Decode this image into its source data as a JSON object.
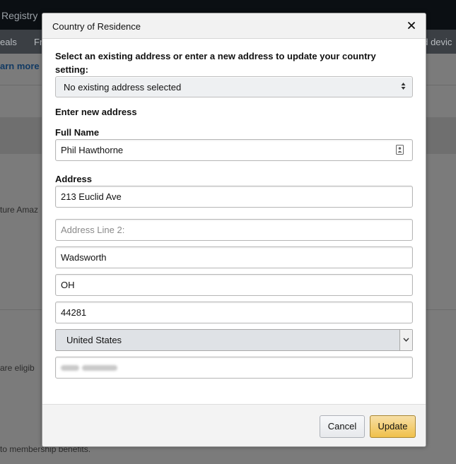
{
  "background": {
    "topbar_text": "Registry",
    "nav_items": [
      "eals",
      "Fr",
      "nd devic"
    ],
    "learn_more": "arn more",
    "body_text_1": "ture Amaz",
    "body_text_2": "are eligib",
    "body_text_3": "to membership benefits."
  },
  "dialog": {
    "title": "Country of Residence",
    "prompt": "Select an existing address or enter a new address to update your country setting:",
    "existing_address": {
      "selected": "No existing address selected"
    },
    "section_label": "Enter new address",
    "full_name": {
      "label": "Full Name",
      "value": "Phil Hawthorne"
    },
    "address": {
      "label": "Address",
      "line1": "213 Euclid Ave",
      "line2_placeholder": "Address Line 2:",
      "line2": "",
      "city": "Wadsworth",
      "state": "OH",
      "zip": "44281",
      "country": "United States"
    },
    "buttons": {
      "cancel": "Cancel",
      "update": "Update"
    }
  },
  "icons": {
    "close": "close-icon",
    "select_arrows": "up-down-arrows-icon",
    "contact_picker": "contact-card-icon",
    "dropdown": "chevron-down-icon"
  },
  "colors": {
    "update_button": "#f0c14b",
    "header_bg": "#f2f2f2",
    "overlay": "#7b7b7b"
  }
}
